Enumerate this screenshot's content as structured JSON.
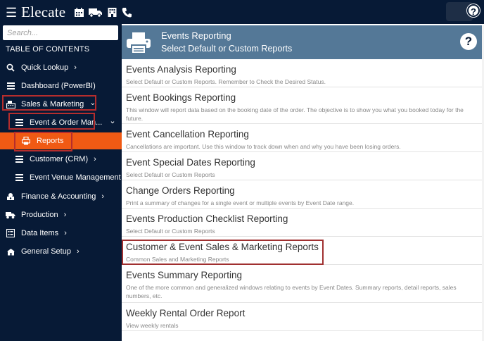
{
  "app": {
    "brand": "Elecate",
    "top_icons": [
      "calendar-icon",
      "truck-icon",
      "building-icon",
      "phone-icon"
    ],
    "help_label": "?"
  },
  "sidebar": {
    "search_placeholder": "Search...",
    "toc_label": "TABLE OF CONTENTS",
    "items": [
      {
        "label": "Quick Lookup",
        "icon": "search-icon",
        "chevron": "›"
      },
      {
        "label": "Dashboard (PowerBI)",
        "icon": "hamburger-icon"
      },
      {
        "label": "Sales & Marketing",
        "icon": "cash-register-icon",
        "chevron": "⌄"
      },
      {
        "label": "Event & Order Man...",
        "icon": "hamburger-icon",
        "chevron": "⌄"
      },
      {
        "label": "Reports",
        "icon": "printer-icon"
      },
      {
        "label": "Customer (CRM)",
        "icon": "hamburger-icon",
        "chevron": "›"
      },
      {
        "label": "Event Venue Management",
        "icon": "hamburger-icon"
      },
      {
        "label": "Finance & Accounting",
        "icon": "money-icon",
        "chevron": "›"
      },
      {
        "label": "Production",
        "icon": "truck-icon",
        "chevron": "›"
      },
      {
        "label": "Data Items",
        "icon": "list-icon",
        "chevron": "›"
      },
      {
        "label": "General Setup",
        "icon": "tools-icon",
        "chevron": "›"
      }
    ]
  },
  "header": {
    "title": "Events Reporting",
    "subtitle": "Select Default or Custom Reports",
    "help_label": "?"
  },
  "reports": [
    {
      "title": "Events Analysis Reporting",
      "desc": "Select Default or Custom Reports. Remember to Check the Desired Status."
    },
    {
      "title": "Event Bookings Reporting",
      "desc": "This window will report data based on the booking date of the order. The objective is to show you what you booked today for the future."
    },
    {
      "title": "Event Cancellation Reporting",
      "desc": "Cancellations are important. Use this window to track down when and why you have been losing orders."
    },
    {
      "title": "Event Special Dates Reporting",
      "desc": "Select Default or Custom Reports"
    },
    {
      "title": "Change Orders Reporting",
      "desc": "Print a summary of changes for a single event or multiple events by Event Date range."
    },
    {
      "title": "Events Production Checklist Reporting",
      "desc": "Select Default or Custom Reports"
    },
    {
      "title": "Customer & Event Sales & Marketing Reports",
      "desc": "Common Sales and Marketing Reports"
    },
    {
      "title": "Events Summary Reporting",
      "desc": "One of the more common and generalized windows relating to events by Event Dates. Summary reports, detail reports, sales numbers, etc."
    },
    {
      "title": "Weekly Rental Order Report",
      "desc": "View weekly rentals"
    }
  ],
  "colors": {
    "nav_bg": "#071a36",
    "header_bg": "#547897",
    "active_item": "#f05a14",
    "highlight_border": "#b52d2d"
  }
}
